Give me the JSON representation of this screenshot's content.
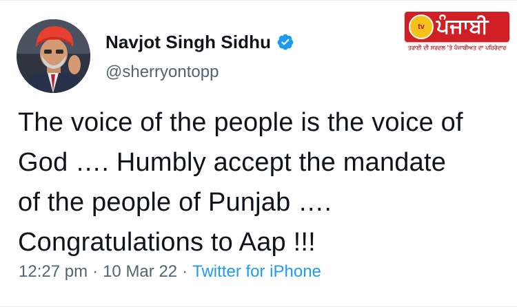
{
  "author": {
    "name": "Navjot Singh Sidhu",
    "handle": "@sherryontopp",
    "verified": true,
    "verified_icon": "verified-badge-icon",
    "verified_color": "#1d9bf0"
  },
  "tweet": {
    "lines": [
      "The voice of the people is the voice of",
      "God …. Humbly accept the mandate",
      "of the people of Punjab ….",
      "Congratulations to Aap !!!"
    ]
  },
  "meta": {
    "time": "12:27 pm",
    "separator": "·",
    "date": "10 Mar 22",
    "source": "Twitter for iPhone",
    "source_color": "#1d9bf0"
  },
  "channel_logo": {
    "badge": "tv",
    "word": "ਪੰਜਾਬੀ",
    "tagline": "ਤਰਾਈ ਦੀ ਸਰਦਲ 'ਤੇ ਪੰਜਾਬੀਅਤ ਦਾ ਪਹਿਰੇਦਾਰ",
    "brand_color": "#d21f26",
    "accent_color": "#f4c21b"
  }
}
